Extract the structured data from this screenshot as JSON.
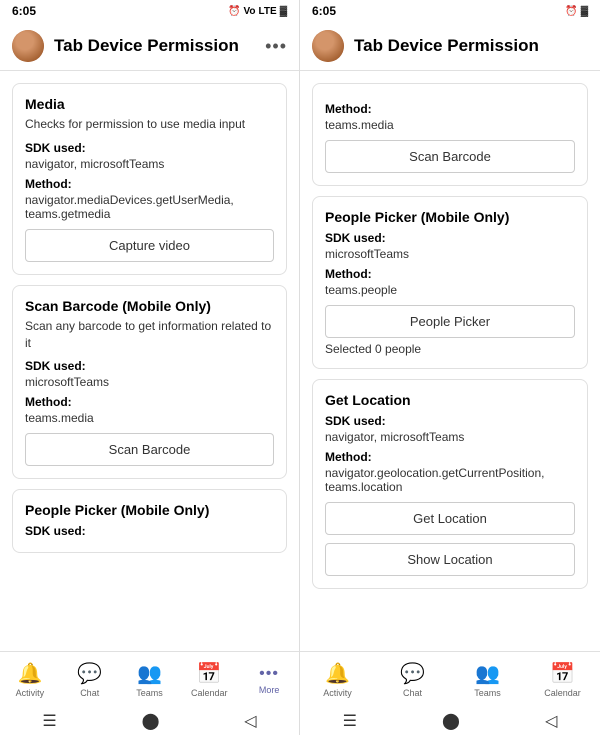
{
  "screens": [
    {
      "id": "left",
      "statusBar": {
        "time": "6:05",
        "icons": "📶 ⚡ 🔋"
      },
      "header": {
        "title": "Tab Device Permission",
        "dotsLabel": "•••"
      },
      "cards": [
        {
          "id": "media",
          "title": "Media",
          "description": "Checks for permission to use media input",
          "sdkLabel": "SDK used:",
          "sdkValue": "navigator, microsoftTeams",
          "methodLabel": "Method:",
          "methodValue": "navigator.mediaDevices.getUserMedia, teams.getmedia",
          "buttonLabel": "Capture video",
          "selectedText": null
        },
        {
          "id": "scanbarcode",
          "title": "Scan Barcode (Mobile Only)",
          "description": "Scan any barcode to get information related to it",
          "sdkLabel": "SDK used:",
          "sdkValue": "microsoftTeams",
          "methodLabel": "Method:",
          "methodValue": "teams.media",
          "buttonLabel": "Scan Barcode",
          "selectedText": null
        },
        {
          "id": "peoplepicker",
          "title": "People Picker (Mobile Only)",
          "description": null,
          "sdkLabel": "SDK used:",
          "sdkValue": "",
          "methodLabel": null,
          "methodValue": null,
          "buttonLabel": null,
          "selectedText": null
        }
      ],
      "nav": [
        {
          "id": "activity",
          "label": "Activity",
          "icon": "🔔",
          "active": false
        },
        {
          "id": "chat",
          "label": "Chat",
          "icon": "💬",
          "active": false
        },
        {
          "id": "teams",
          "label": "Teams",
          "icon": "👥",
          "active": false
        },
        {
          "id": "calendar",
          "label": "Calendar",
          "icon": "📅",
          "active": false
        },
        {
          "id": "more",
          "label": "More",
          "icon": "•••",
          "active": true
        }
      ]
    },
    {
      "id": "right",
      "statusBar": {
        "time": "6:05",
        "icons": "📶 ⚡"
      },
      "header": {
        "title": "Tab Device Permission",
        "dotsLabel": "•••"
      },
      "sections": [
        {
          "id": "scanbarcode-right",
          "methodLabel": "Method:",
          "methodValue": "teams.media",
          "buttonLabel": "Scan Barcode",
          "selectedText": null,
          "showTitle": false
        },
        {
          "id": "peoplepicker-right",
          "title": "People Picker (Mobile Only)",
          "sdkLabel": "SDK used:",
          "sdkValue": "microsoftTeams",
          "methodLabel": "Method:",
          "methodValue": "teams.people",
          "buttonLabel": "People Picker",
          "selectedText": "Selected 0 people",
          "showTitle": true
        },
        {
          "id": "getlocation-right",
          "title": "Get Location",
          "sdkLabel": "SDK used:",
          "sdkValue": "navigator, microsoftTeams",
          "methodLabel": "Method:",
          "methodValue": "navigator.geolocation.getCurrentPosition, teams.location",
          "buttonLabel": "Get Location",
          "button2Label": "Show Location",
          "showTitle": true
        }
      ],
      "nav": [
        {
          "id": "activity",
          "label": "Activity",
          "icon": "🔔",
          "active": false
        },
        {
          "id": "chat",
          "label": "Chat",
          "icon": "💬",
          "active": false
        },
        {
          "id": "teams",
          "label": "Teams",
          "icon": "👥",
          "active": false
        },
        {
          "id": "calendar",
          "label": "Calendar",
          "icon": "📅",
          "active": false
        }
      ]
    }
  ]
}
